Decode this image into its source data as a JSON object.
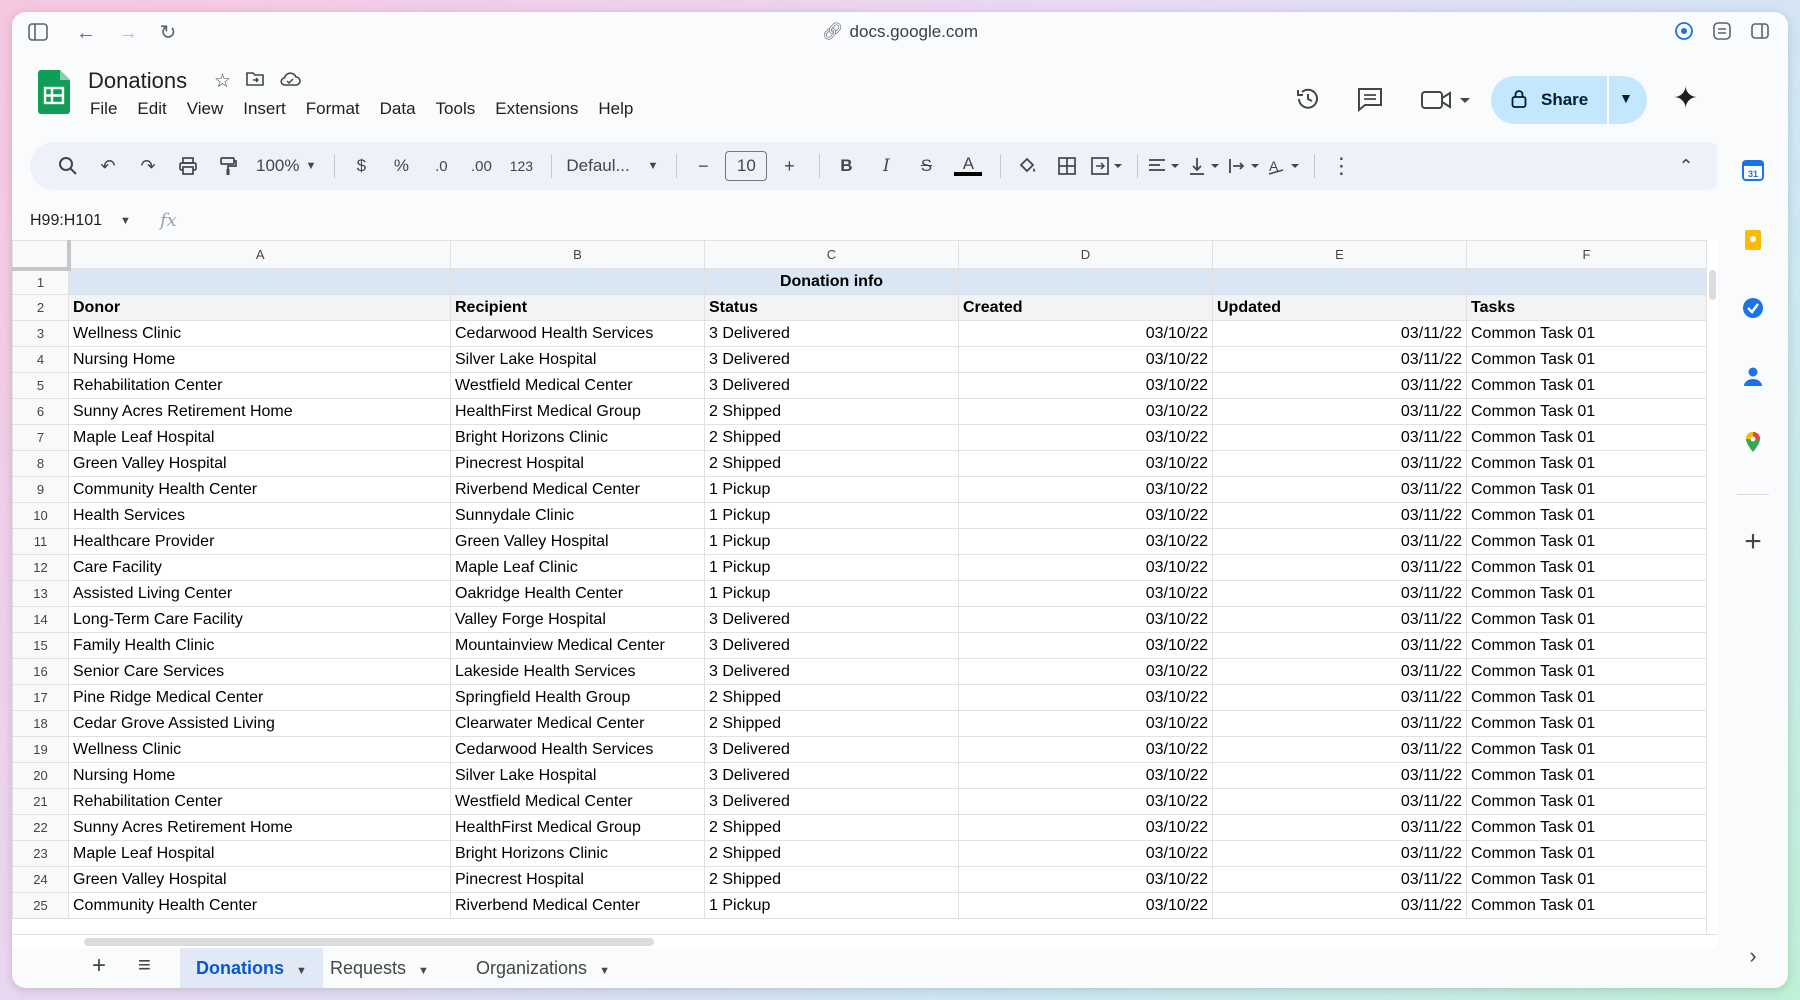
{
  "browser": {
    "url": "docs.google.com"
  },
  "doc": {
    "title": "Donations",
    "menus": [
      "File",
      "Edit",
      "View",
      "Insert",
      "Format",
      "Data",
      "Tools",
      "Extensions",
      "Help"
    ],
    "share_label": "Share"
  },
  "toolbar": {
    "zoom": "100%",
    "currency": "$",
    "percent": "%",
    "dec_decrease": ".0",
    "dec_increase": ".00",
    "number_format": "123",
    "font": "Defaul...",
    "font_size": "10",
    "bold": "B",
    "italic": "I",
    "strike": "S",
    "text_color": "A"
  },
  "formula_bar": {
    "name_box": "H99:H101",
    "fx": "fx"
  },
  "grid": {
    "columns": [
      "A",
      "B",
      "C",
      "D",
      "E",
      "F"
    ],
    "header_row1": {
      "c": "Donation info"
    },
    "headers": [
      "Donor",
      "Recipient",
      "Status",
      "Created",
      "Updated",
      "Tasks"
    ],
    "rows": [
      [
        "Wellness Clinic",
        "Cedarwood Health Services",
        "3 Delivered",
        "03/10/22",
        "03/11/22",
        "Common Task 01"
      ],
      [
        "Nursing Home",
        "Silver Lake Hospital",
        "3 Delivered",
        "03/10/22",
        "03/11/22",
        "Common Task 01"
      ],
      [
        "Rehabilitation Center",
        "Westfield Medical Center",
        "3 Delivered",
        "03/10/22",
        "03/11/22",
        "Common Task 01"
      ],
      [
        "Sunny Acres Retirement Home",
        "HealthFirst Medical Group",
        "2 Shipped",
        "03/10/22",
        "03/11/22",
        "Common Task 01"
      ],
      [
        "Maple Leaf Hospital",
        "Bright Horizons Clinic",
        "2 Shipped",
        "03/10/22",
        "03/11/22",
        "Common Task 01"
      ],
      [
        "Green Valley Hospital",
        "Pinecrest Hospital",
        "2 Shipped",
        "03/10/22",
        "03/11/22",
        "Common Task 01"
      ],
      [
        "Community Health Center",
        "Riverbend Medical Center",
        "1 Pickup",
        "03/10/22",
        "03/11/22",
        "Common Task 01"
      ],
      [
        "Health Services",
        "Sunnydale Clinic",
        "1 Pickup",
        "03/10/22",
        "03/11/22",
        "Common Task 01"
      ],
      [
        "Healthcare Provider",
        "Green Valley Hospital",
        "1 Pickup",
        "03/10/22",
        "03/11/22",
        "Common Task 01"
      ],
      [
        "Care Facility",
        "Maple Leaf Clinic",
        "1 Pickup",
        "03/10/22",
        "03/11/22",
        "Common Task 01"
      ],
      [
        "Assisted Living Center",
        "Oakridge Health Center",
        "1 Pickup",
        "03/10/22",
        "03/11/22",
        "Common Task 01"
      ],
      [
        "Long-Term Care Facility",
        "Valley Forge Hospital",
        "3 Delivered",
        "03/10/22",
        "03/11/22",
        "Common Task 01"
      ],
      [
        "Family Health Clinic",
        "Mountainview Medical Center",
        "3 Delivered",
        "03/10/22",
        "03/11/22",
        "Common Task 01"
      ],
      [
        "Senior Care Services",
        "Lakeside Health Services",
        "3 Delivered",
        "03/10/22",
        "03/11/22",
        "Common Task 01"
      ],
      [
        "Pine Ridge Medical Center",
        "Springfield Health Group",
        "2 Shipped",
        "03/10/22",
        "03/11/22",
        "Common Task 01"
      ],
      [
        "Cedar Grove Assisted Living",
        "Clearwater Medical Center",
        "2 Shipped",
        "03/10/22",
        "03/11/22",
        "Common Task 01"
      ],
      [
        "Wellness Clinic",
        "Cedarwood Health Services",
        "3 Delivered",
        "03/10/22",
        "03/11/22",
        "Common Task 01"
      ],
      [
        "Nursing Home",
        "Silver Lake Hospital",
        "3 Delivered",
        "03/10/22",
        "03/11/22",
        "Common Task 01"
      ],
      [
        "Rehabilitation Center",
        "Westfield Medical Center",
        "3 Delivered",
        "03/10/22",
        "03/11/22",
        "Common Task 01"
      ],
      [
        "Sunny Acres Retirement Home",
        "HealthFirst Medical Group",
        "2 Shipped",
        "03/10/22",
        "03/11/22",
        "Common Task 01"
      ],
      [
        "Maple Leaf Hospital",
        "Bright Horizons Clinic",
        "2 Shipped",
        "03/10/22",
        "03/11/22",
        "Common Task 01"
      ],
      [
        "Green Valley Hospital",
        "Pinecrest Hospital",
        "2 Shipped",
        "03/10/22",
        "03/11/22",
        "Common Task 01"
      ],
      [
        "Community Health Center",
        "Riverbend Medical Center",
        "1 Pickup",
        "03/10/22",
        "03/11/22",
        "Common Task 01"
      ]
    ]
  },
  "sheets": [
    {
      "label": "Donations",
      "active": true
    },
    {
      "label": "Requests",
      "active": false
    },
    {
      "label": "Organizations",
      "active": false
    }
  ],
  "colors": {
    "accent": "#0b57d0",
    "share_bg": "#c2e7ff",
    "header_fill": "#d9e7f5",
    "sheets_green": "#0f9d58"
  }
}
